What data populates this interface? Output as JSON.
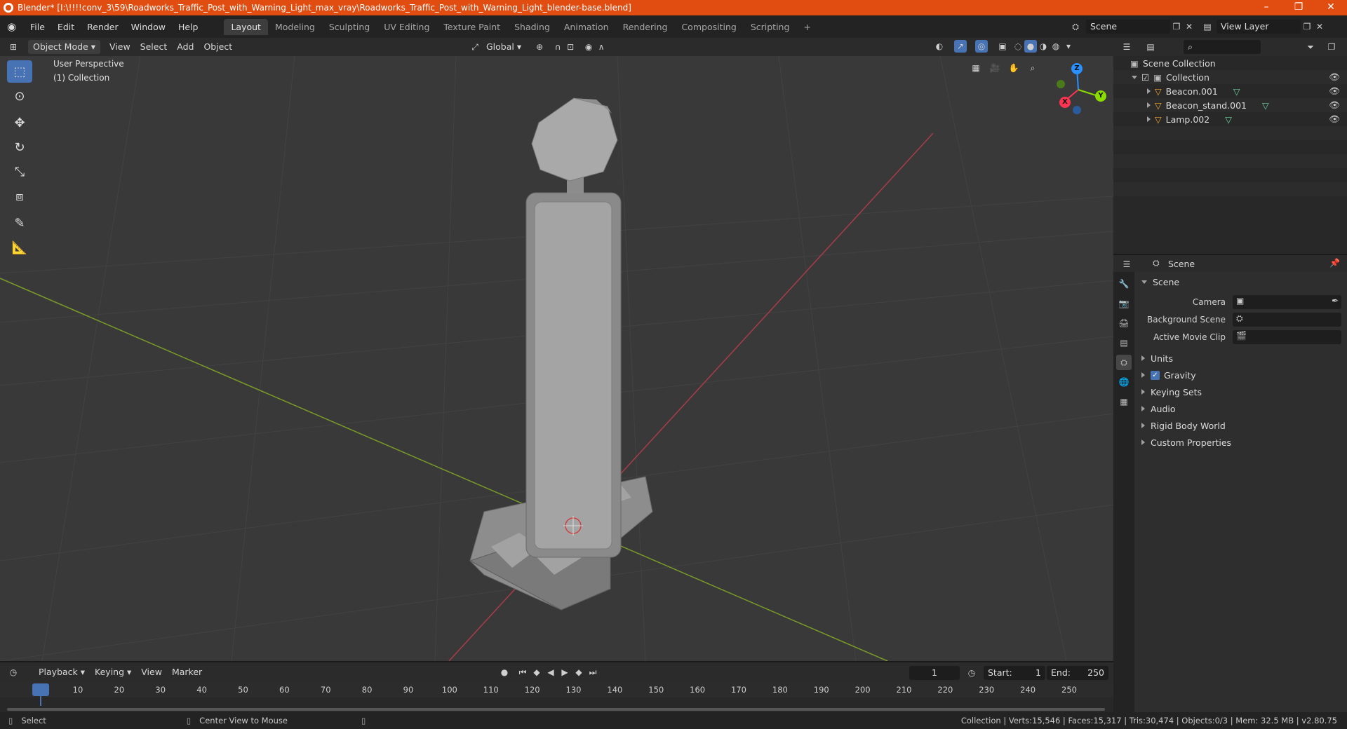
{
  "window": {
    "title": "Blender* [I:\\!!!!conv_3\\59\\Roadworks_Traffic_Post_with_Warning_Light_max_vray\\Roadworks_Traffic_Post_with_Warning_Light_blender-base.blend]",
    "minimize": "–",
    "maximize": "❐",
    "close": "✕"
  },
  "menu": [
    "File",
    "Edit",
    "Render",
    "Window",
    "Help"
  ],
  "workspaces": [
    "Layout",
    "Modeling",
    "Sculpting",
    "UV Editing",
    "Texture Paint",
    "Shading",
    "Animation",
    "Rendering",
    "Compositing",
    "Scripting"
  ],
  "add_workspace": "+",
  "scene_field": "Scene",
  "view_layer_field": "View Layer",
  "viewport_header": {
    "mode": "Object Mode",
    "menus": [
      "View",
      "Select",
      "Add",
      "Object"
    ],
    "transform": "Global"
  },
  "viewport": {
    "perspective": "User Perspective",
    "collection": "(1) Collection"
  },
  "gizmo": {
    "z": "Z",
    "y": "Y",
    "x": "X"
  },
  "outliner": {
    "root": "Scene Collection",
    "collection": "Collection",
    "items": [
      "Beacon.001",
      "Beacon_stand.001",
      "Lamp.002"
    ]
  },
  "properties": {
    "header": "Scene",
    "section": "Scene",
    "fields": [
      {
        "label": "Camera"
      },
      {
        "label": "Background Scene"
      },
      {
        "label": "Active Movie Clip"
      }
    ],
    "panels": [
      "Units",
      "Gravity",
      "Keying Sets",
      "Audio",
      "Rigid Body World",
      "Custom Properties"
    ]
  },
  "timeline": {
    "menus": [
      "Playback",
      "Keying",
      "View",
      "Marker"
    ],
    "current_frame": "1",
    "start_label": "Start:",
    "start": "1",
    "end_label": "End:",
    "end": "250",
    "ticks": [
      "1",
      "10",
      "20",
      "30",
      "40",
      "50",
      "60",
      "70",
      "80",
      "90",
      "100",
      "110",
      "120",
      "130",
      "140",
      "150",
      "160",
      "170",
      "180",
      "190",
      "200",
      "210",
      "220",
      "230",
      "240",
      "250"
    ]
  },
  "status": {
    "left": "Select",
    "middle": "Center View to Mouse",
    "right": "Collection | Verts:15,546 | Faces:15,317 | Tris:30,474 | Objects:0/3 | Mem: 32.5 MB | v2.80.75"
  },
  "colors": {
    "titlebar": "#e14c10",
    "accent": "#4772b3",
    "x_axis": "#ff3352",
    "y_axis": "#8bdc00",
    "z_axis": "#2890ff"
  }
}
